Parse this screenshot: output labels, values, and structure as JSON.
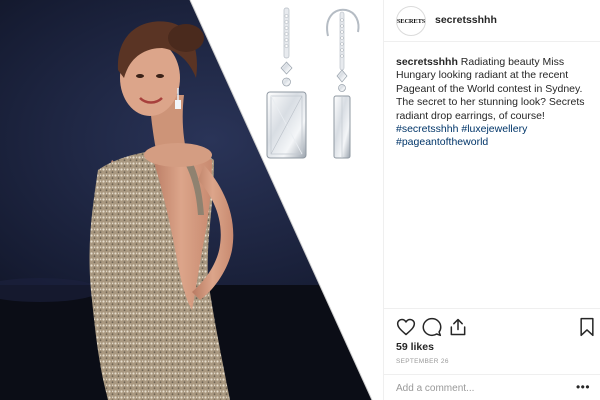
{
  "post": {
    "avatar_text": "SECRETS",
    "username": "secretsshhh",
    "caption": {
      "user": "secretsshhh",
      "text": "Radiating beauty Miss Hungary looking radiant at the recent Pageant of the World contest in Sydney. The secret to her stunning look? Secrets radiant drop earrings, of course!",
      "hashtags": [
        "#secretsshhh",
        "#luxejewellery",
        "#pageantoftheworld"
      ]
    },
    "likes": "59 likes",
    "date": "SEPTEMBER 26",
    "comment_placeholder": "Add a comment...",
    "more_label": "•••"
  },
  "icons": {
    "like": "heart-icon",
    "comment": "comment-icon",
    "share": "share-icon",
    "save": "bookmark-icon"
  },
  "colors": {
    "photo_dark": "#141a2e",
    "gown": "#b8aa95",
    "skin": "#d39a80",
    "hair": "#5a3424",
    "hashtag": "#003569",
    "border": "#efefef",
    "muted": "#999999"
  }
}
